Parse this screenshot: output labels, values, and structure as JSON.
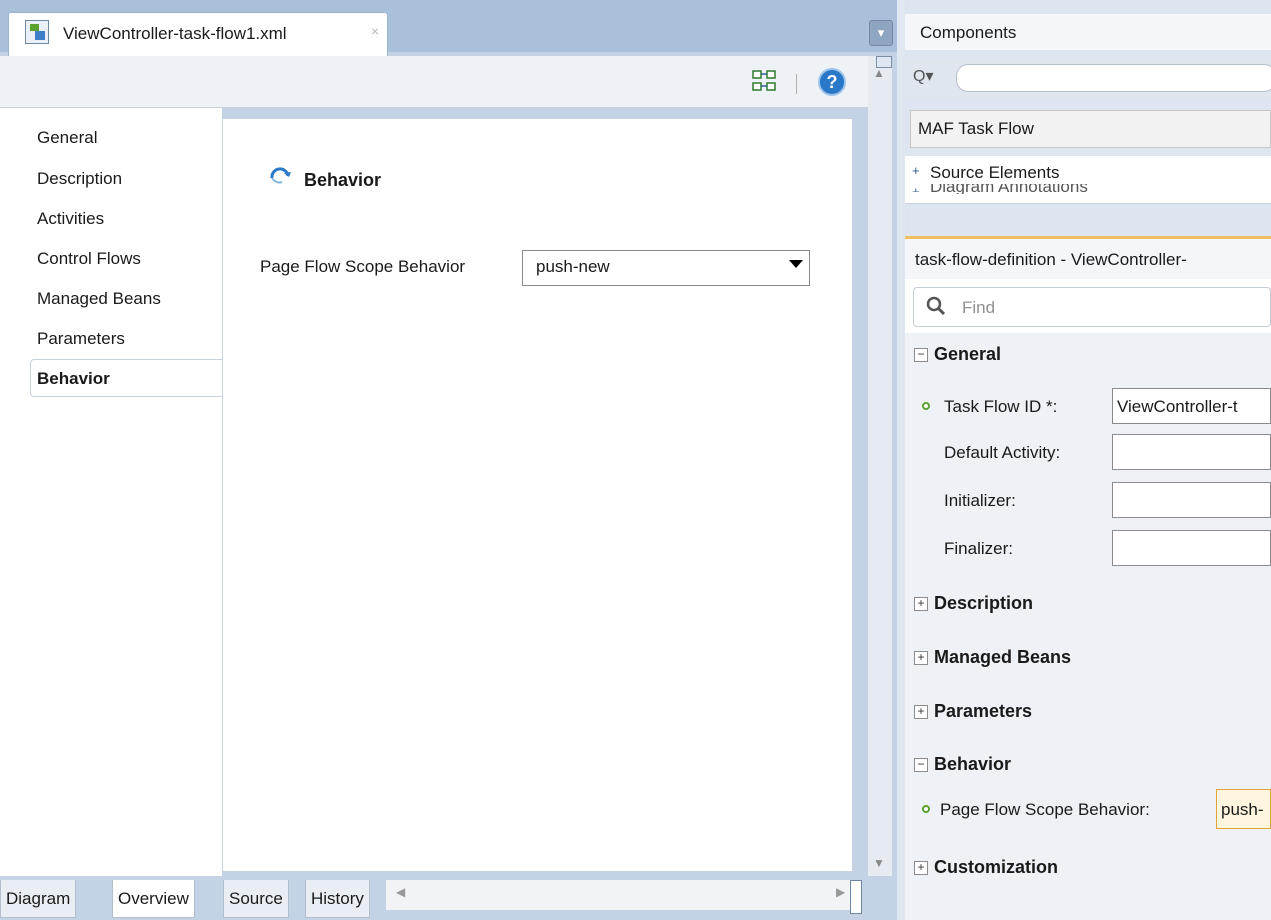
{
  "editor": {
    "tab_title": "ViewController-task-flow1.xml",
    "tab_close": "×",
    "dropdown_glyph": "▾",
    "help_glyph": "?",
    "nav_items": [
      "General",
      "Description",
      "Activities",
      "Control Flows",
      "Managed Beans",
      "Parameters",
      "Behavior"
    ],
    "selected_nav": "Behavior",
    "section_title": "Behavior",
    "field_label": "Page Flow Scope Behavior",
    "field_value": "push-new",
    "bottom_tabs": [
      "Diagram",
      "Overview",
      "Source",
      "History"
    ],
    "selected_bottom_tab": "Overview",
    "scroll_left": "◀",
    "scroll_right": "▶",
    "scroll_up": "▲",
    "scroll_down": "▼"
  },
  "components": {
    "title": "Components",
    "search_glyph": "Q▾",
    "palette_value": "MAF Task Flow",
    "expand_glyph": "+",
    "accordion_item": "Source Elements",
    "accordion_item_clipped": "Diagram Annotations"
  },
  "properties": {
    "title": "task-flow-definition - ViewController-",
    "find_placeholder": "Find",
    "expanded_glyph": "−",
    "collapsed_glyph": "+",
    "general_section": "General",
    "task_flow_id_label": "Task Flow ID *:",
    "task_flow_id_value": "ViewController-t",
    "default_activity_label": "Default Activity:",
    "initializer_label": "Initializer:",
    "finalizer_label": "Finalizer:",
    "description_section": "Description",
    "managed_beans_section": "Managed Beans",
    "parameters_section": "Parameters",
    "behavior_section": "Behavior",
    "pfs_label": "Page Flow Scope Behavior:",
    "pfs_value": "push-",
    "customization_section": "Customization"
  },
  "colors": {
    "tabstrip": "#a9c0db",
    "accent_blue": "#2a78c8",
    "required_green": "#5aa22d",
    "active_input_border": "#e2a53a"
  }
}
